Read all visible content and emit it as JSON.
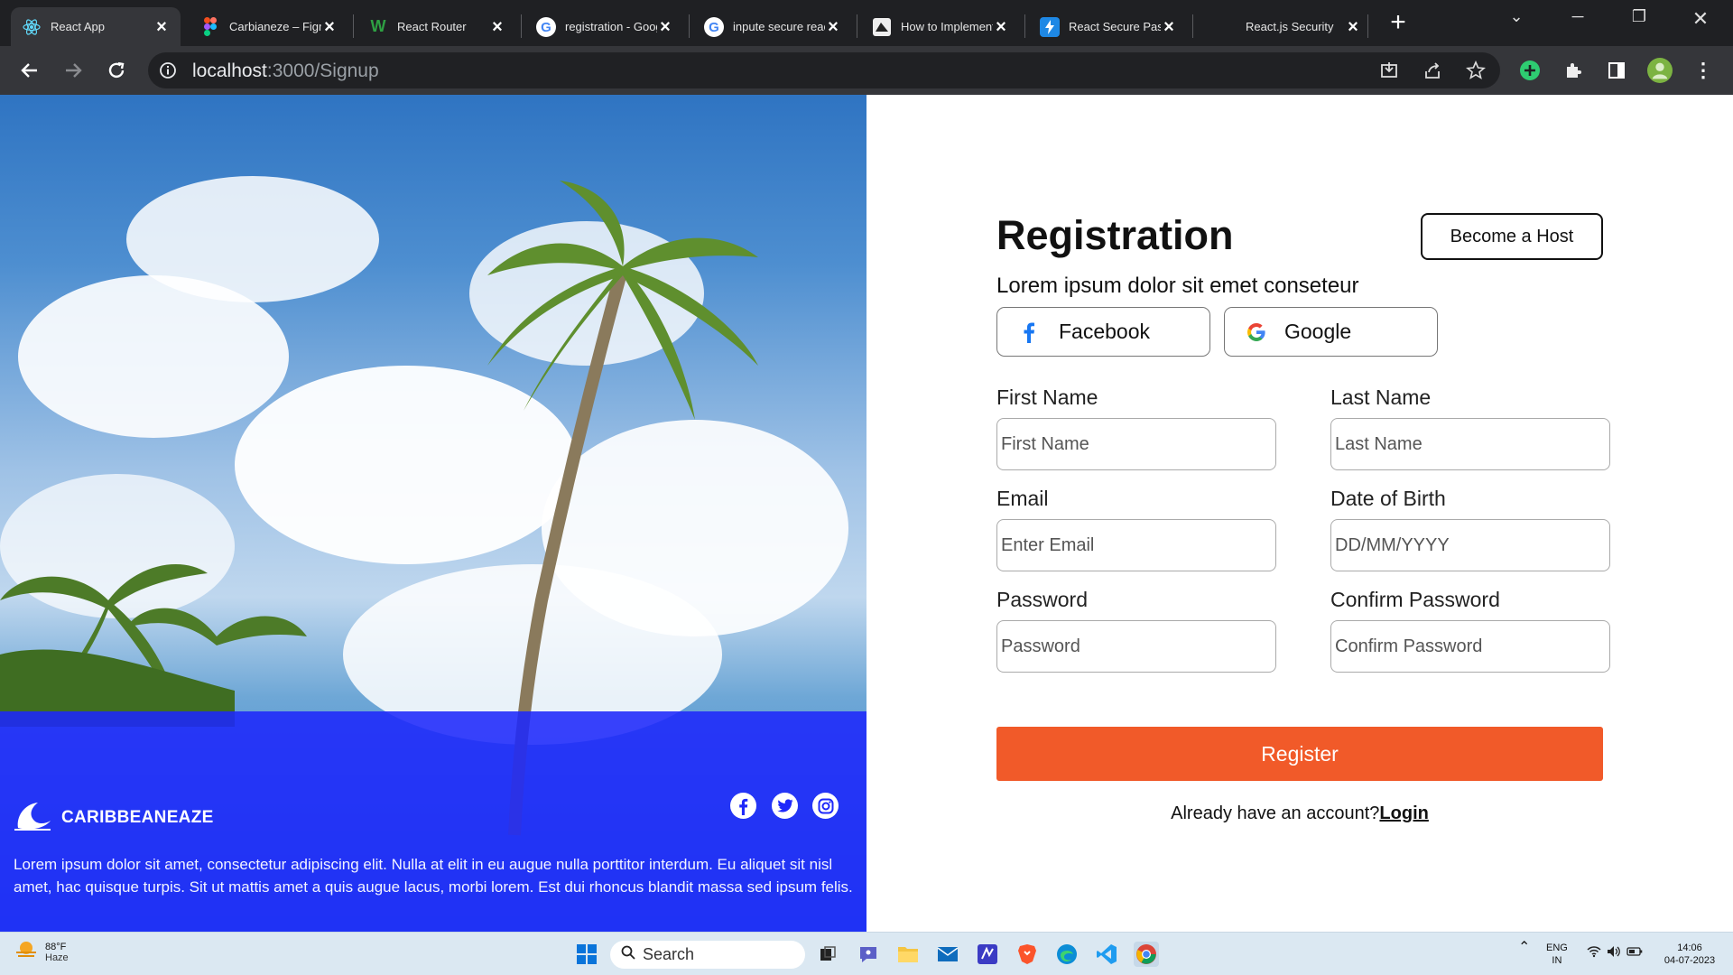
{
  "browser": {
    "tabs": [
      {
        "title": "React App",
        "active": true
      },
      {
        "title": "Carbianeze – Figma"
      },
      {
        "title": "React Router"
      },
      {
        "title": "registration - Google"
      },
      {
        "title": "inpute secure react"
      },
      {
        "title": "How to Implement"
      },
      {
        "title": "React Secure Pass"
      },
      {
        "title": "React.js Security"
      }
    ],
    "url_host": "localhost",
    "url_path": ":3000/Signup"
  },
  "hero": {
    "brand": "CARIBBEANEAZE",
    "description": "Lorem ipsum dolor sit amet, consectetur adipiscing elit. Nulla at elit in eu augue nulla porttitor interdum. Eu aliquet sit nisl amet, hac quisque turpis. Sit ut mattis amet a quis augue lacus, morbi lorem. Est dui rhoncus blandit massa sed ipsum felis.",
    "social_icons": [
      "facebook-icon",
      "twitter-icon",
      "instagram-icon"
    ]
  },
  "form": {
    "title": "Registration",
    "subtitle": "Lorem ipsum dolor sit emet conseteur",
    "host_button": "Become a Host",
    "facebook_label": "Facebook",
    "google_label": "Google",
    "first_name": {
      "label": "First Name",
      "placeholder": "First Name"
    },
    "last_name": {
      "label": "Last Name",
      "placeholder": "Last Name"
    },
    "email": {
      "label": "Email",
      "placeholder": "Enter Email"
    },
    "dob": {
      "label": "Date of Birth",
      "placeholder": "DD/MM/YYYY"
    },
    "password": {
      "label": "Password",
      "placeholder": "Password"
    },
    "confirm_password": {
      "label": "Confirm Password",
      "placeholder": "Confirm Password"
    },
    "register_button": "Register",
    "already_text": "Already have an account?",
    "login_link": "Login",
    "accent_color": "#f15a29"
  },
  "taskbar": {
    "weather_temp": "88°F",
    "weather_desc": "Haze",
    "search_label": "Search",
    "lang_1": "ENG",
    "lang_2": "IN",
    "time": "14:06",
    "date": "04-07-2023"
  }
}
